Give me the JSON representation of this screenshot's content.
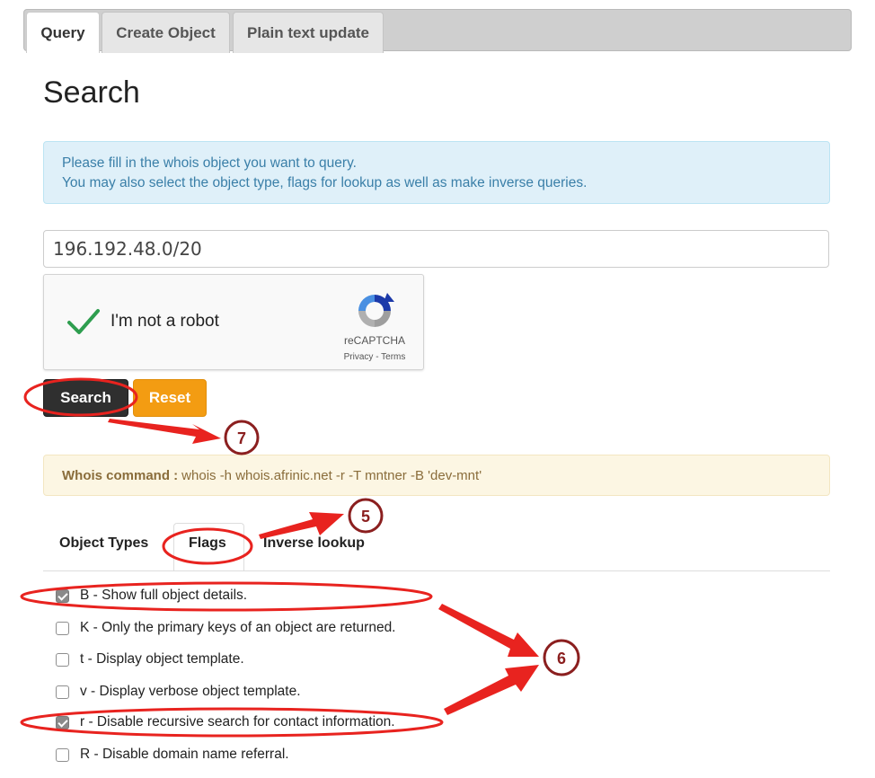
{
  "top_tabs": [
    {
      "label": "Query",
      "active": true
    },
    {
      "label": "Create Object",
      "active": false
    },
    {
      "label": "Plain text update",
      "active": false
    }
  ],
  "page_title": "Search",
  "info": {
    "line1": "Please fill in the whois object you want to query.",
    "line2": "You may also select the object type, flags for lookup as well as make inverse queries."
  },
  "query": {
    "value": "196.192.48.0/20"
  },
  "captcha": {
    "label": "I'm not a robot",
    "brand": "reCAPTCHA",
    "links": "Privacy - Terms"
  },
  "buttons": {
    "search": "Search",
    "reset": "Reset"
  },
  "whois_command": {
    "label": "Whois command :",
    "value": "whois -h whois.afrinic.net -r -T mntner -B 'dev-mnt'"
  },
  "sub_tabs": [
    {
      "label": "Object Types",
      "active": false
    },
    {
      "label": "Flags",
      "active": true
    },
    {
      "label": "Inverse lookup",
      "active": false
    }
  ],
  "flags": [
    {
      "label": "B - Show full object details.",
      "checked": true
    },
    {
      "label": "K - Only the primary keys of an object are returned.",
      "checked": false
    },
    {
      "label": "t - Display object template.",
      "checked": false
    },
    {
      "label": "v - Display verbose object template.",
      "checked": false
    },
    {
      "label": "r - Disable recursive search for contact information.",
      "checked": true
    },
    {
      "label": "R - Disable domain name referral.",
      "checked": false
    }
  ],
  "annotations": {
    "marker_5": "5",
    "marker_6": "6",
    "marker_7": "7",
    "color": "#e8231f"
  },
  "colors": {
    "info_bg": "#dff0f9",
    "info_text": "#3a7fa8",
    "cmd_bg": "#fcf6e3",
    "cmd_text": "#8a6d3b",
    "search_btn": "#2f2f2f",
    "reset_btn": "#f39c12",
    "check_green": "#2e9e4f"
  }
}
